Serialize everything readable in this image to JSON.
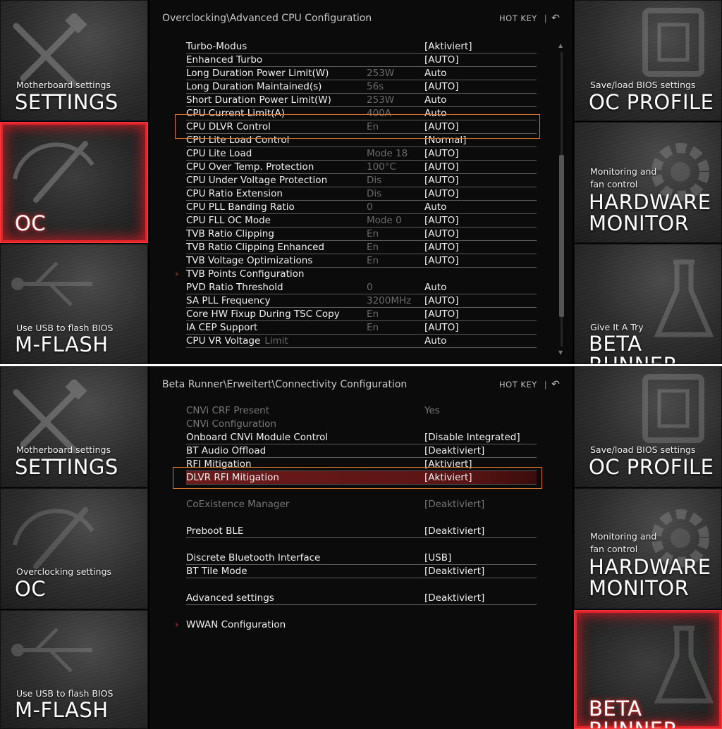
{
  "top": {
    "left_tiles": [
      {
        "sub": "Motherboard settings",
        "big": "SETTINGS"
      },
      {
        "sub": "",
        "big": "OC"
      },
      {
        "sub": "Use USB to flash BIOS",
        "big": "M-FLASH"
      }
    ],
    "right_tiles": [
      {
        "sub": "Save/load BIOS settings",
        "big": "OC PROFILE"
      },
      {
        "sub1": "Monitoring and",
        "sub2": "fan control",
        "big1": "HARDWARE",
        "big2": "MONITOR"
      },
      {
        "sub": "Give It A Try",
        "big": "BETA RUNNER"
      }
    ],
    "breadcrumb": "Overclocking\\Advanced CPU Configuration",
    "hotkey": "HOT KEY",
    "hotkey_sep": "|",
    "undo_icon": "↶",
    "rows": [
      {
        "label": "Turbo-Modus",
        "mid": "",
        "value": "[Aktiviert]"
      },
      {
        "label": "Enhanced Turbo",
        "mid": "",
        "value": "[AUTO]"
      },
      {
        "label": "Long Duration Power Limit(W)",
        "mid": "253W",
        "value": "Auto"
      },
      {
        "label": "Long Duration Maintained(s)",
        "mid": "56s",
        "value": "[AUTO]"
      },
      {
        "label": "Short Duration Power Limit(W)",
        "mid": "253W",
        "value": "Auto"
      },
      {
        "label": "CPU Current Limit(A)",
        "mid": "400A",
        "value": "Auto"
      },
      {
        "label": "CPU DLVR Control",
        "mid": "En",
        "value": "[AUTO]"
      },
      {
        "label": "CPU Lite Load Control",
        "mid": "",
        "value": "[Normal]"
      },
      {
        "label": "CPU Lite Load",
        "mid": "Mode 18",
        "value": "[AUTO]"
      },
      {
        "label": "CPU Over Temp. Protection",
        "mid": "100°C",
        "value": "[AUTO]"
      },
      {
        "label": "CPU Under Voltage Protection",
        "mid": "Dis",
        "value": "[AUTO]"
      },
      {
        "label": "CPU Ratio Extension",
        "mid": "Dis",
        "value": "[AUTO]"
      },
      {
        "label": "CPU PLL Banding Ratio",
        "mid": "0",
        "value": "Auto"
      },
      {
        "label": "CPU FLL OC Mode",
        "mid": "Mode 0",
        "value": "[AUTO]"
      },
      {
        "label": "TVB Ratio Clipping",
        "mid": "En",
        "value": "[AUTO]"
      },
      {
        "label": "TVB Ratio Clipping Enhanced",
        "mid": "En",
        "value": "[AUTO]"
      },
      {
        "label": "TVB Voltage Optimizations",
        "mid": "En",
        "value": "[AUTO]"
      },
      {
        "label": "TVB Points Configuration",
        "mid": "",
        "value": ""
      },
      {
        "label": "PVD Ratio Threshold",
        "mid": "0",
        "value": "Auto"
      },
      {
        "label": "SA PLL Frequency",
        "mid": "3200MHz",
        "value": "[AUTO]"
      },
      {
        "label": "Core HW Fixup During TSC Copy",
        "mid": "En",
        "value": "[AUTO]"
      },
      {
        "label": "IA CEP Support",
        "mid": "En",
        "value": "[AUTO]"
      },
      {
        "label": "CPU VR Voltage",
        "inline": "Limit",
        "mid": "",
        "value": "Auto"
      }
    ],
    "submenu_arrow": "›"
  },
  "bottom": {
    "left_tiles": [
      {
        "sub": "Motherboard settings",
        "big": "SETTINGS"
      },
      {
        "sub": "Overclocking settings",
        "big": "OC"
      },
      {
        "sub": "Use USB to flash BIOS",
        "big": "M-FLASH"
      }
    ],
    "right_tiles": [
      {
        "sub": "Save/load BIOS settings",
        "big": "OC PROFILE"
      },
      {
        "sub1": "Monitoring and",
        "sub2": "fan control",
        "big1": "HARDWARE",
        "big2": "MONITOR"
      },
      {
        "sub": "",
        "big": "BETA RUNNER"
      }
    ],
    "breadcrumb": "Beta Runner\\Erweitert\\Connectivity Configuration",
    "hotkey": "HOT KEY",
    "hotkey_sep": "|",
    "undo_icon": "↶",
    "rows": [
      {
        "label": "CNVi CRF Present",
        "value": "Yes"
      },
      {
        "label": "CNVi Configuration",
        "value": ""
      },
      {
        "label": "Onboard CNVi Module Control",
        "value": "[Disable Integrated]"
      },
      {
        "label": "BT Audio Offload",
        "value": "[Deaktiviert]"
      },
      {
        "label": "RFI Mitigation",
        "value": "[Aktiviert]"
      },
      {
        "label": "DLVR RFI Mitigation",
        "value": "[Aktiviert]"
      },
      {
        "label": "CoExistence Manager",
        "value": "[Deaktiviert]"
      },
      {
        "label": "Preboot BLE",
        "value": "[Deaktiviert]"
      },
      {
        "label": "Discrete Bluetooth Interface",
        "value": "[USB]"
      },
      {
        "label": "BT Tile Mode",
        "value": "[Deaktiviert]"
      },
      {
        "label": "Advanced settings",
        "value": "[Deaktiviert]"
      },
      {
        "label": "WWAN Configuration",
        "value": ""
      }
    ],
    "submenu_arrow": "›"
  },
  "colors": {
    "accent_red": "#e0242a",
    "highlight_orange": "#d9772e",
    "selected_row": "#6d1b1b"
  }
}
